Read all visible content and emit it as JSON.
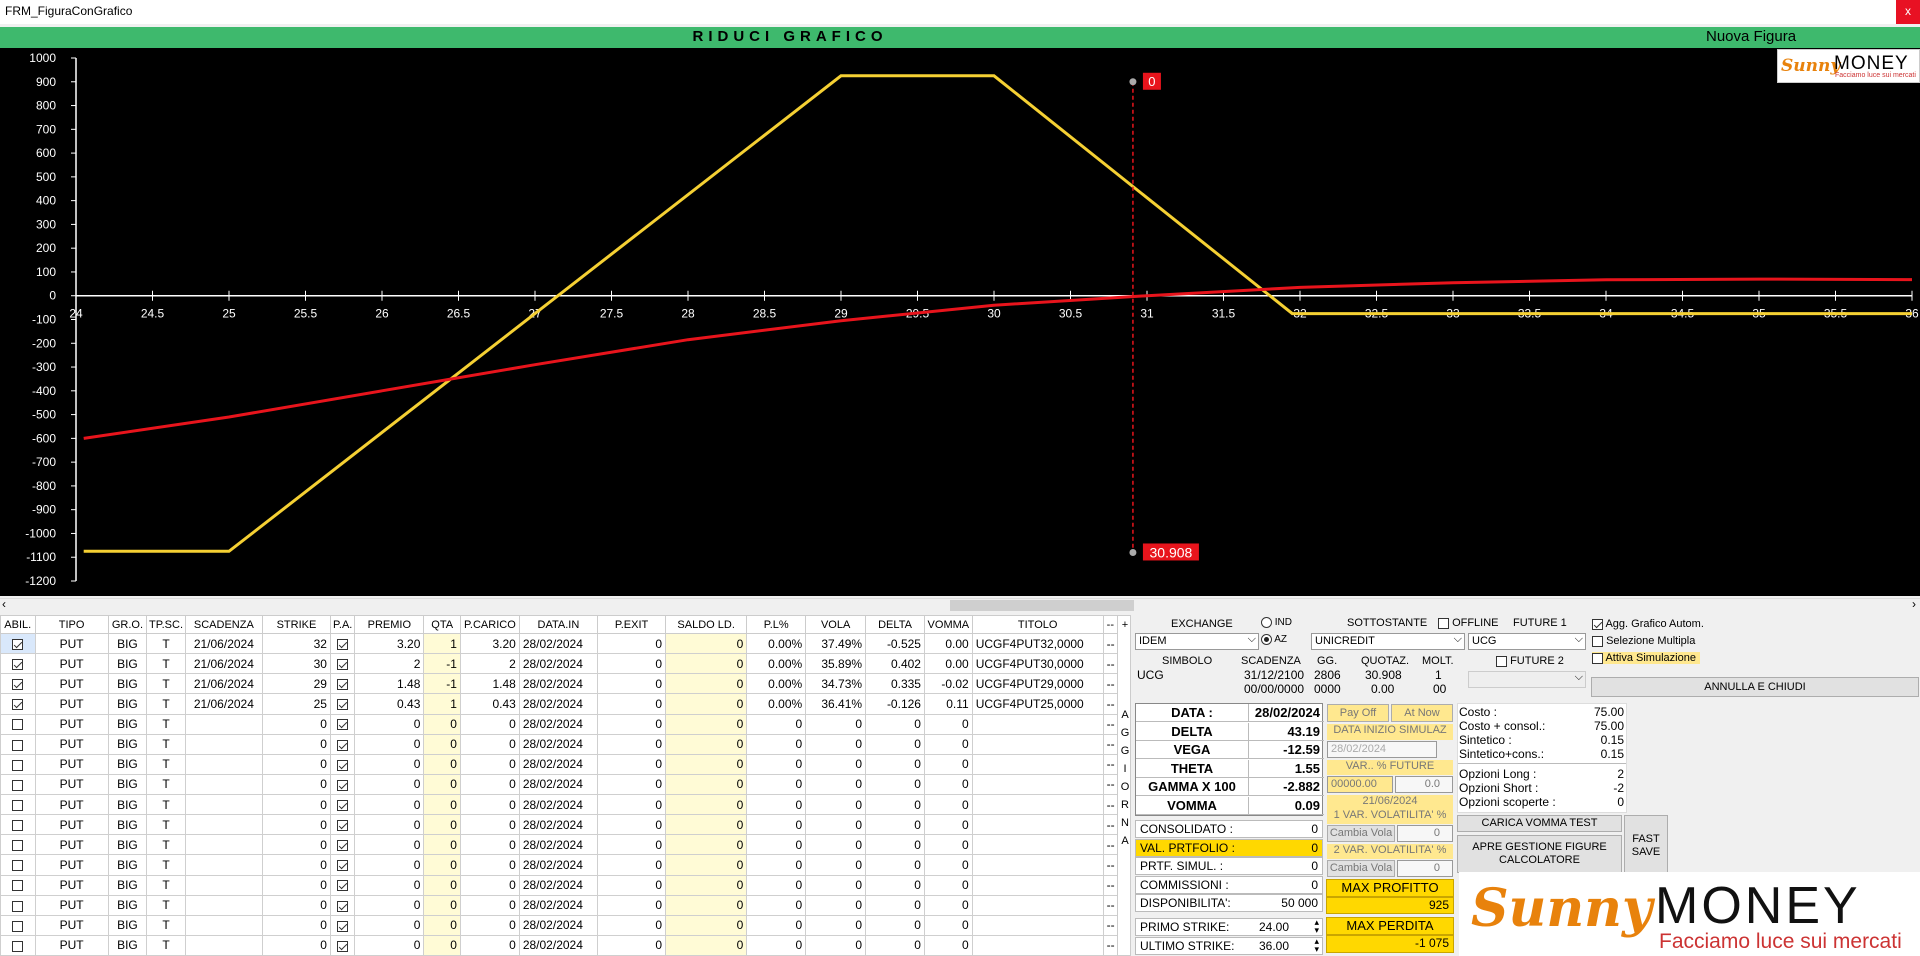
{
  "window": {
    "title": "FRM_FiguraConGrafico",
    "close_label": "x"
  },
  "header": {
    "center_label": "RIDUCI GRAFICO",
    "right_label": "Nuova Figura"
  },
  "logo_small": {
    "sunny": "Sunny",
    "money": "MONEY",
    "tagline": "Facciamo luce sui mercati"
  },
  "chart_data": {
    "type": "line",
    "x_ticks": [
      24,
      24.5,
      25,
      25.5,
      26,
      26.5,
      27,
      27.5,
      28,
      28.5,
      29,
      29.5,
      30,
      30.5,
      31,
      31.5,
      32,
      32.5,
      33,
      33.5,
      34,
      34.5,
      35,
      35.5,
      36
    ],
    "y_ticks": [
      1000,
      900,
      800,
      700,
      600,
      500,
      400,
      300,
      200,
      100,
      0,
      -100,
      -200,
      -300,
      -400,
      -500,
      -600,
      -700,
      -800,
      -900,
      -1000,
      -1100,
      -1200
    ],
    "xlim": [
      24,
      36
    ],
    "ylim": [
      -1200,
      1000
    ],
    "series": [
      {
        "name": "",
        "color": "#f5d033",
        "points": [
          [
            24.05,
            -1075
          ],
          [
            25,
            -1075
          ],
          [
            29,
            925
          ],
          [
            30,
            925
          ],
          [
            31.95,
            -75
          ],
          [
            36,
            -75
          ]
        ]
      },
      {
        "name": "",
        "color": "#e8141c",
        "points": [
          [
            24.05,
            -600
          ],
          [
            25,
            -510
          ],
          [
            26,
            -400
          ],
          [
            27,
            -290
          ],
          [
            28,
            -185
          ],
          [
            29,
            -105
          ],
          [
            30,
            -40
          ],
          [
            31,
            0
          ],
          [
            32,
            35
          ],
          [
            33,
            55
          ],
          [
            34,
            67
          ],
          [
            35,
            70
          ],
          [
            36,
            68
          ]
        ]
      }
    ],
    "marker": {
      "x": 30.908,
      "top_label": "0",
      "bottom_label": "30.908",
      "color": "#e8141c"
    }
  },
  "grid": {
    "columns": [
      "ABIL.",
      "TIPO",
      "GR.O.",
      "TP.SC.",
      "SCADENZA",
      "STRIKE",
      "P.A.",
      "PREMIO",
      "QTA",
      "P.CARICO",
      "DATA.IN",
      "P.EXIT",
      "SALDO LD.",
      "P.L%",
      "VOLA",
      "DELTA",
      "VOMMA",
      "TITOLO",
      "--"
    ],
    "rows": [
      {
        "abil": true,
        "tipo": "PUT",
        "gro": "BIG",
        "tpsc": "T",
        "scadenza": "21/06/2024",
        "strike": "32",
        "pa": true,
        "premio": "3.20",
        "qta": "1",
        "pcarico": "3.20",
        "datain": "28/02/2024",
        "pexit": "0",
        "saldo": "0",
        "pl": "0.00%",
        "vola": "37.49%",
        "delta": "-0.525",
        "vomma": "0.00",
        "titolo": "UCGF4PUT32,0000",
        "x": "--"
      },
      {
        "abil": true,
        "tipo": "PUT",
        "gro": "BIG",
        "tpsc": "T",
        "scadenza": "21/06/2024",
        "strike": "30",
        "pa": true,
        "premio": "2",
        "qta": "-1",
        "pcarico": "2",
        "datain": "28/02/2024",
        "pexit": "0",
        "saldo": "0",
        "pl": "0.00%",
        "vola": "35.89%",
        "delta": "0.402",
        "vomma": "0.00",
        "titolo": "UCGF4PUT30,0000",
        "x": "--"
      },
      {
        "abil": true,
        "tipo": "PUT",
        "gro": "BIG",
        "tpsc": "T",
        "scadenza": "21/06/2024",
        "strike": "29",
        "pa": true,
        "premio": "1.48",
        "qta": "-1",
        "pcarico": "1.48",
        "datain": "28/02/2024",
        "pexit": "0",
        "saldo": "0",
        "pl": "0.00%",
        "vola": "34.73%",
        "delta": "0.335",
        "vomma": "-0.02",
        "titolo": "UCGF4PUT29,0000",
        "x": "--"
      },
      {
        "abil": true,
        "tipo": "PUT",
        "gro": "BIG",
        "tpsc": "T",
        "scadenza": "21/06/2024",
        "strike": "25",
        "pa": true,
        "premio": "0.43",
        "qta": "1",
        "pcarico": "0.43",
        "datain": "28/02/2024",
        "pexit": "0",
        "saldo": "0",
        "pl": "0.00%",
        "vola": "36.41%",
        "delta": "-0.126",
        "vomma": "0.11",
        "titolo": "UCGF4PUT25,0000",
        "x": "--"
      },
      {
        "abil": false,
        "tipo": "PUT",
        "gro": "BIG",
        "tpsc": "T",
        "scadenza": "",
        "strike": "0",
        "pa": true,
        "premio": "0",
        "qta": "0",
        "pcarico": "0",
        "datain": "28/02/2024",
        "pexit": "0",
        "saldo": "0",
        "pl": "0",
        "vola": "0",
        "delta": "0",
        "vomma": "0",
        "titolo": "",
        "x": "--"
      },
      {
        "abil": false,
        "tipo": "PUT",
        "gro": "BIG",
        "tpsc": "T",
        "scadenza": "",
        "strike": "0",
        "pa": true,
        "premio": "0",
        "qta": "0",
        "pcarico": "0",
        "datain": "28/02/2024",
        "pexit": "0",
        "saldo": "0",
        "pl": "0",
        "vola": "0",
        "delta": "0",
        "vomma": "0",
        "titolo": "",
        "x": "--"
      },
      {
        "abil": false,
        "tipo": "PUT",
        "gro": "BIG",
        "tpsc": "T",
        "scadenza": "",
        "strike": "0",
        "pa": true,
        "premio": "0",
        "qta": "0",
        "pcarico": "0",
        "datain": "28/02/2024",
        "pexit": "0",
        "saldo": "0",
        "pl": "0",
        "vola": "0",
        "delta": "0",
        "vomma": "0",
        "titolo": "",
        "x": "--"
      },
      {
        "abil": false,
        "tipo": "PUT",
        "gro": "BIG",
        "tpsc": "T",
        "scadenza": "",
        "strike": "0",
        "pa": true,
        "premio": "0",
        "qta": "0",
        "pcarico": "0",
        "datain": "28/02/2024",
        "pexit": "0",
        "saldo": "0",
        "pl": "0",
        "vola": "0",
        "delta": "0",
        "vomma": "0",
        "titolo": "",
        "x": "--"
      },
      {
        "abil": false,
        "tipo": "PUT",
        "gro": "BIG",
        "tpsc": "T",
        "scadenza": "",
        "strike": "0",
        "pa": true,
        "premio": "0",
        "qta": "0",
        "pcarico": "0",
        "datain": "28/02/2024",
        "pexit": "0",
        "saldo": "0",
        "pl": "0",
        "vola": "0",
        "delta": "0",
        "vomma": "0",
        "titolo": "",
        "x": "--"
      },
      {
        "abil": false,
        "tipo": "PUT",
        "gro": "BIG",
        "tpsc": "T",
        "scadenza": "",
        "strike": "0",
        "pa": true,
        "premio": "0",
        "qta": "0",
        "pcarico": "0",
        "datain": "28/02/2024",
        "pexit": "0",
        "saldo": "0",
        "pl": "0",
        "vola": "0",
        "delta": "0",
        "vomma": "0",
        "titolo": "",
        "x": "--"
      },
      {
        "abil": false,
        "tipo": "PUT",
        "gro": "BIG",
        "tpsc": "T",
        "scadenza": "",
        "strike": "0",
        "pa": true,
        "premio": "0",
        "qta": "0",
        "pcarico": "0",
        "datain": "28/02/2024",
        "pexit": "0",
        "saldo": "0",
        "pl": "0",
        "vola": "0",
        "delta": "0",
        "vomma": "0",
        "titolo": "",
        "x": "--"
      },
      {
        "abil": false,
        "tipo": "PUT",
        "gro": "BIG",
        "tpsc": "T",
        "scadenza": "",
        "strike": "0",
        "pa": true,
        "premio": "0",
        "qta": "0",
        "pcarico": "0",
        "datain": "28/02/2024",
        "pexit": "0",
        "saldo": "0",
        "pl": "0",
        "vola": "0",
        "delta": "0",
        "vomma": "0",
        "titolo": "",
        "x": "--"
      },
      {
        "abil": false,
        "tipo": "PUT",
        "gro": "BIG",
        "tpsc": "T",
        "scadenza": "",
        "strike": "0",
        "pa": true,
        "premio": "0",
        "qta": "0",
        "pcarico": "0",
        "datain": "28/02/2024",
        "pexit": "0",
        "saldo": "0",
        "pl": "0",
        "vola": "0",
        "delta": "0",
        "vomma": "0",
        "titolo": "",
        "x": "--"
      },
      {
        "abil": false,
        "tipo": "PUT",
        "gro": "BIG",
        "tpsc": "T",
        "scadenza": "",
        "strike": "0",
        "pa": true,
        "premio": "0",
        "qta": "0",
        "pcarico": "0",
        "datain": "28/02/2024",
        "pexit": "0",
        "saldo": "0",
        "pl": "0",
        "vola": "0",
        "delta": "0",
        "vomma": "0",
        "titolo": "",
        "x": "--"
      },
      {
        "abil": false,
        "tipo": "PUT",
        "gro": "BIG",
        "tpsc": "T",
        "scadenza": "",
        "strike": "0",
        "pa": true,
        "premio": "0",
        "qta": "0",
        "pcarico": "0",
        "datain": "28/02/2024",
        "pexit": "0",
        "saldo": "0",
        "pl": "0",
        "vola": "0",
        "delta": "0",
        "vomma": "0",
        "titolo": "",
        "x": "--"
      },
      {
        "abil": false,
        "tipo": "PUT",
        "gro": "BIG",
        "tpsc": "T",
        "scadenza": "",
        "strike": "0",
        "pa": true,
        "premio": "0",
        "qta": "0",
        "pcarico": "0",
        "datain": "28/02/2024",
        "pexit": "0",
        "saldo": "0",
        "pl": "0",
        "vola": "0",
        "delta": "0",
        "vomma": "0",
        "titolo": "",
        "x": "--"
      }
    ]
  },
  "aggiorna": {
    "plus": "+",
    "letters": [
      "A",
      "G",
      "G",
      "I",
      "O",
      "R",
      "N",
      "A"
    ]
  },
  "exchange": {
    "label": "EXCHANGE",
    "value": "IDEM",
    "radio_ind": "IND",
    "radio_az": "AZ",
    "sottostante_label": "SOTTOSTANTE",
    "sottostante_value": "UNICREDIT",
    "offline_label": "OFFLINE",
    "future1_label": "FUTURE 1",
    "future1_value": "UCG",
    "future2_label": "FUTURE 2",
    "simbolo_label": "SIMBOLO",
    "simbolo_value": "UCG",
    "scadenza_label": "SCADENZA",
    "scadenza_value1": "31/12/2100",
    "scadenza_value2": "00/00/0000",
    "gg_label": "GG.",
    "gg_value1": "2806",
    "gg_value2": "0000",
    "quotaz_label": "QUOTAZ.",
    "quotaz_value1": "30.908",
    "quotaz_value2": "0.00",
    "molt_label": "MOLT.",
    "molt_value1": "1",
    "molt_value2": "00"
  },
  "options": {
    "agg_grafico": "Agg. Grafico Autom.",
    "selezione_multipla": "Selezione Multipla",
    "attiva_simulazione": "Attiva Simulazione",
    "annulla": "ANNULLA E CHIUDI"
  },
  "greeks": [
    {
      "k": "DATA :",
      "v": "28/02/2024"
    },
    {
      "k": "DELTA",
      "v": "43.19"
    },
    {
      "k": "VEGA",
      "v": "-12.59"
    },
    {
      "k": "THETA",
      "v": "1.55"
    },
    {
      "k": "GAMMA X 100",
      "v": "-2.882"
    },
    {
      "k": "VOMMA",
      "v": "0.09"
    }
  ],
  "portfolio": [
    {
      "k": "CONSOLIDATO :",
      "v": "0",
      "hl": false
    },
    {
      "k": "VAL. PRTFOLIO :",
      "v": "0",
      "hl": true
    },
    {
      "k": "PRTF. SIMUL. :",
      "v": "0",
      "hl": false
    },
    {
      "k": "COMMISSIONI :",
      "v": "0",
      "hl": false
    },
    {
      "k": "DISPONIBILITA':",
      "v": "50 000",
      "hl": false
    }
  ],
  "strikes": {
    "primo_label": "PRIMO STRIKE:",
    "primo_value": "24.00",
    "ultimo_label": "ULTIMO STRIKE:",
    "ultimo_value": "36.00"
  },
  "simulation": {
    "payoff": "Pay Off",
    "atnow": "At Now",
    "data_inizio": "DATA INIZIO SIMULAZ",
    "data_inizio_value": "28/02/2024",
    "var_future": "VAR.. % FUTURE",
    "future_value": "00000.00",
    "future_pct": "0.0",
    "scad_date": "21/06/2024",
    "var_vol1": "1 VAR. VOLATILITA' %",
    "cambia_vola1": "Cambia Vola",
    "vol1_value": "0",
    "var_vol2": "2 VAR. VOLATILITA' %",
    "cambia_vola2": "Cambia Vola",
    "vol2_value": "0"
  },
  "maxpl": {
    "profit_label": "MAX PROFITTO",
    "profit_value": "925",
    "loss_label": "MAX PERDITA",
    "loss_value": "-1 075"
  },
  "costs": [
    {
      "k": "Costo :",
      "v": "75.00"
    },
    {
      "k": "Costo + consol.:",
      "v": "75.00"
    },
    {
      "k": "Sintetico :",
      "v": "0.15"
    },
    {
      "k": "Sintetico+cons.:",
      "v": "0.15"
    },
    {
      "k": "Opzioni Long :",
      "v": "2"
    },
    {
      "k": "Opzioni Short :",
      "v": "-2"
    },
    {
      "k": "Opzioni scoperte :",
      "v": "0"
    }
  ],
  "buttons": {
    "carica_vomma": "CARICA VOMMA TEST",
    "apre_gestione": "APRE GESTIONE FIGURE CALCOLATORE",
    "fast_save": "FAST SAVE"
  },
  "logo_big": {
    "sunny": "Sunny",
    "money": "MONEY",
    "tagline": "Facciamo luce sui mercati"
  }
}
